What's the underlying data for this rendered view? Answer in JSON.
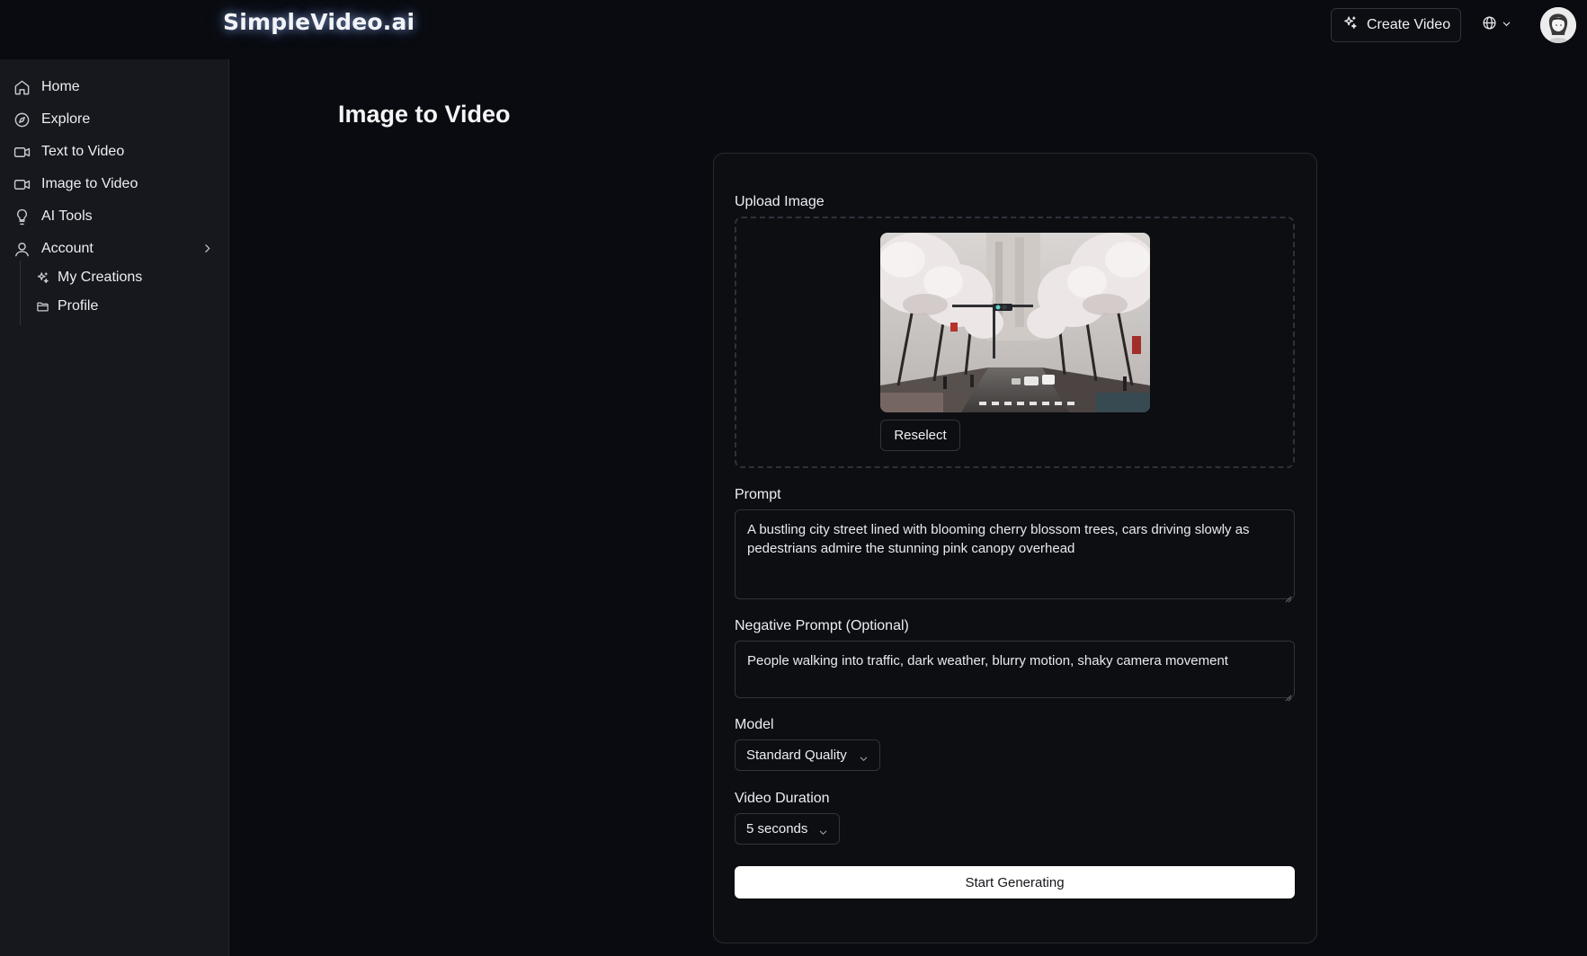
{
  "app": {
    "logo": "SimpleVideo.ai"
  },
  "header": {
    "create_label": "Create Video",
    "create_icon": "sparkles-icon",
    "language_icon": "globe-icon"
  },
  "sidebar": {
    "items": [
      {
        "label": "Home",
        "icon": "home-icon"
      },
      {
        "label": "Explore",
        "icon": "compass-icon"
      },
      {
        "label": "Text to Video",
        "icon": "video-camera-icon"
      },
      {
        "label": "Image to Video",
        "icon": "video-camera-icon"
      },
      {
        "label": "AI Tools",
        "icon": "lightbulb-icon"
      },
      {
        "label": "Account",
        "icon": "user-icon"
      }
    ],
    "subitems": [
      {
        "label": "My Creations",
        "icon": "sparkles-icon"
      },
      {
        "label": "Profile",
        "icon": "folder-icon"
      }
    ]
  },
  "main": {
    "title": "Image to Video",
    "upload_label": "Upload Image",
    "reselect_label": "Reselect",
    "prompt_label": "Prompt",
    "prompt_value": "A bustling city street lined with blooming cherry blossom trees, cars driving slowly as pedestrians admire the stunning pink canopy overhead",
    "negative_label": "Negative Prompt (Optional)",
    "negative_value": "People walking into traffic, dark weather, blurry motion, shaky camera movement",
    "model_label": "Model",
    "model_value": "Standard Quality",
    "duration_label": "Video Duration",
    "duration_value": "5 seconds",
    "start_label": "Start Generating"
  },
  "colors": {
    "background": "#090b10",
    "sidebar": "#16181d",
    "card": "#0c0e12",
    "border": "#30343c",
    "primary_button": "#ffffff"
  }
}
